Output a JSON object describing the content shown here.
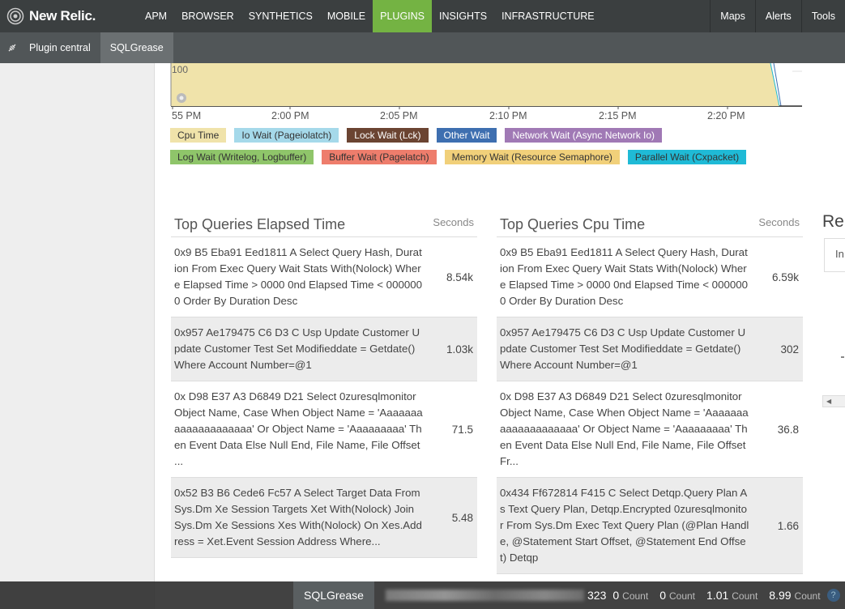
{
  "brand": {
    "name": "New Relic."
  },
  "nav": {
    "items": [
      {
        "label": "APM",
        "active": false
      },
      {
        "label": "BROWSER",
        "active": false
      },
      {
        "label": "SYNTHETICS",
        "active": false
      },
      {
        "label": "MOBILE",
        "active": false
      },
      {
        "label": "PLUGINS",
        "active": true
      },
      {
        "label": "INSIGHTS",
        "active": false
      },
      {
        "label": "INFRASTRUCTURE",
        "active": false
      }
    ],
    "right": [
      "Maps",
      "Alerts",
      "Tools"
    ]
  },
  "subnav": {
    "items": [
      "Plugin central",
      "SQLGrease"
    ],
    "active": "SQLGrease"
  },
  "chart": {
    "y_tick": "100",
    "x_ticks": [
      "55 PM",
      "2:00 PM",
      "2:05 PM",
      "2:10 PM",
      "2:15 PM",
      "2:20 PM"
    ],
    "legend_row1": [
      {
        "label": "Cpu Time",
        "color": "#f0e3aa",
        "text": "#333"
      },
      {
        "label": "Io Wait (Pageiolatch)",
        "color": "#a5d9ea",
        "text": "#333"
      },
      {
        "label": "Lock Wait (Lck)",
        "color": "#6b4432",
        "text": "#fff"
      },
      {
        "label": "Other Wait",
        "color": "#3e6fb0",
        "text": "#fff"
      },
      {
        "label": "Network Wait (Async Network Io)",
        "color": "#a079b5",
        "text": "#fff"
      }
    ],
    "legend_row2": [
      {
        "label": "Log Wait (Writelog, Logbuffer)",
        "color": "#8fc56a",
        "text": "#333"
      },
      {
        "label": "Buffer Wait (Pagelatch)",
        "color": "#ee7d6c",
        "text": "#333"
      },
      {
        "label": "Memory Wait (Resource Semaphore)",
        "color": "#f1d07a",
        "text": "#333"
      },
      {
        "label": "Parallel Wait (Cxpacket)",
        "color": "#1fbad6",
        "text": "#333"
      }
    ]
  },
  "elapsed": {
    "title": "Top Queries Elapsed Time",
    "unit": "Seconds",
    "rows": [
      {
        "query": "0x9 B5 Eba91 Eed1811 A Select Query Hash, Duration From Exec Query Wait Stats With(Nolock) Where Elapsed Time > 0000 0nd Elapsed Time < 0000000 Order By Duration Desc",
        "value": "8.54k"
      },
      {
        "query": "0x957 Ae179475 C6 D3 C Usp Update Customer Update Customer Test Set Modifieddate = Getdate() Where Account Number=@1",
        "value": "1.03k"
      },
      {
        "query": "0x D98 E37 A3 D6849 D21 Select 0zuresqlmonitor Object Name, Case When Object Name = 'Aaaaaaaaaaaaaaaaaaaa' Or Object Name = 'Aaaaaaaaa' Then Event Data Else Null End, File Name, File Offset ...",
        "value": "71.5"
      },
      {
        "query": "0x52 B3 B6 Cede6 Fc57 A Select Target Data From Sys.Dm Xe Session Targets Xet With(Nolock) Join Sys.Dm Xe Sessions Xes With(Nolock) On Xes.Address = Xet.Event Session Address Where...",
        "value": "5.48"
      }
    ]
  },
  "cpu": {
    "title": "Top Queries Cpu Time",
    "unit": "Seconds",
    "rows": [
      {
        "query": "0x9 B5 Eba91 Eed1811 A Select Query Hash, Duration From Exec Query Wait Stats With(Nolock) Where Elapsed Time > 0000 0nd Elapsed Time < 0000000 Order By Duration Desc",
        "value": "6.59k"
      },
      {
        "query": "0x957 Ae179475 C6 D3 C Usp Update Customer Update Customer Test Set Modifieddate = Getdate() Where Account Number=@1",
        "value": "302"
      },
      {
        "query": "0x D98 E37 A3 D6849 D21 Select 0zuresqlmonitor Object Name, Case When Object Name = 'Aaaaaaaaaaaaaaaaaaaa' Or Object Name = 'Aaaaaaaaa' Then Event Data Else Null End, File Name, File Offset Fr...",
        "value": "36.8"
      },
      {
        "query": "0x434 Ff672814 F415 C Select Detqp.Query Plan As Text Query Plan, Detqp.Encrypted 0zuresqlmonitor From Sys.Dm Exec Text Query Plan (@Plan Handle, @Statement Start Offset, @Statement End Offset) Detqp",
        "value": "1.66"
      }
    ]
  },
  "partial_right": {
    "title": "Re",
    "box_text": "In"
  },
  "bottombar": {
    "app": "SQLGrease",
    "metrics": [
      {
        "value": "323",
        "label": ""
      },
      {
        "value": "0",
        "label": "Count"
      },
      {
        "value": "0",
        "label": "Count"
      },
      {
        "value": "1.01",
        "label": "Count"
      },
      {
        "value": "8.99",
        "label": "Count"
      }
    ]
  }
}
